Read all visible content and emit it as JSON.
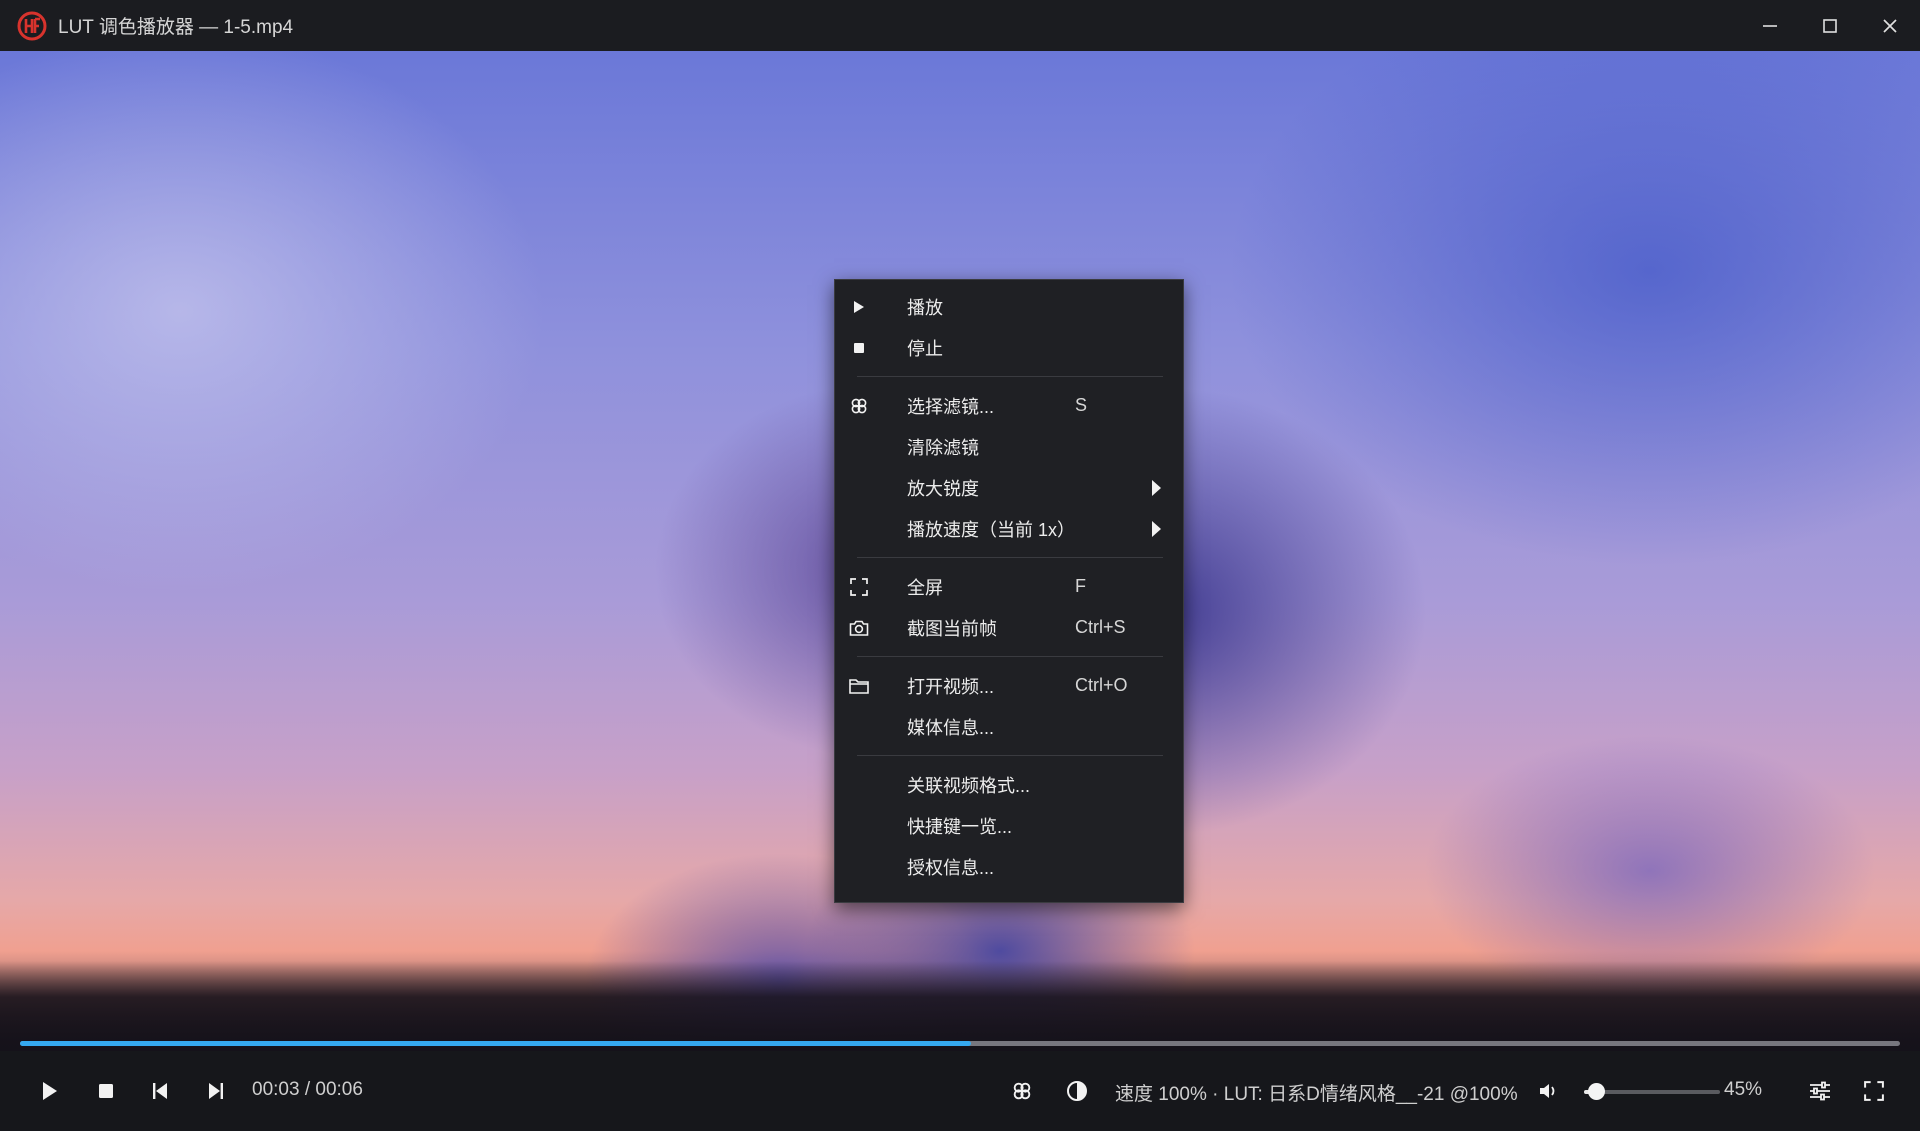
{
  "window": {
    "title": "LUT 调色播放器 — 1-5.mp4",
    "logo_icon": "app-logo-icon",
    "accent_logo": "#d8332d"
  },
  "video": {
    "description_icon": "video-frame"
  },
  "context_menu": {
    "items": [
      {
        "label": "播放",
        "shortcut": "",
        "icon": "play-icon",
        "submenu": false
      },
      {
        "label": "停止",
        "shortcut": "",
        "icon": "stop-icon",
        "submenu": false
      },
      {
        "label": "选择滤镜...",
        "shortcut": "S",
        "icon": "filter-icon",
        "submenu": false
      },
      {
        "label": "清除滤镜",
        "shortcut": "",
        "icon": "",
        "submenu": false
      },
      {
        "label": "放大锐度",
        "shortcut": "",
        "icon": "",
        "submenu": true
      },
      {
        "label": "播放速度（当前 1x）",
        "shortcut": "",
        "icon": "",
        "submenu": true
      },
      {
        "label": "全屏",
        "shortcut": "F",
        "icon": "fullscreen-icon",
        "submenu": false
      },
      {
        "label": "截图当前帧",
        "shortcut": "Ctrl+S",
        "icon": "camera-icon",
        "submenu": false
      },
      {
        "label": "打开视频...",
        "shortcut": "Ctrl+O",
        "icon": "folder-icon",
        "submenu": false
      },
      {
        "label": "媒体信息...",
        "shortcut": "",
        "icon": "",
        "submenu": false
      },
      {
        "label": "关联视频格式...",
        "shortcut": "",
        "icon": "",
        "submenu": false
      },
      {
        "label": "快捷键一览...",
        "shortcut": "",
        "icon": "",
        "submenu": false
      },
      {
        "label": "授权信息...",
        "shortcut": "",
        "icon": "",
        "submenu": false
      }
    ]
  },
  "controls": {
    "progress": 0.506,
    "progress_color": "#35a8f0",
    "time": "00:03 / 00:06",
    "status": "速度 100% · LUT: 日系D情绪风格__-21 @100%",
    "volume": 0.45,
    "volume_label": "45%"
  }
}
